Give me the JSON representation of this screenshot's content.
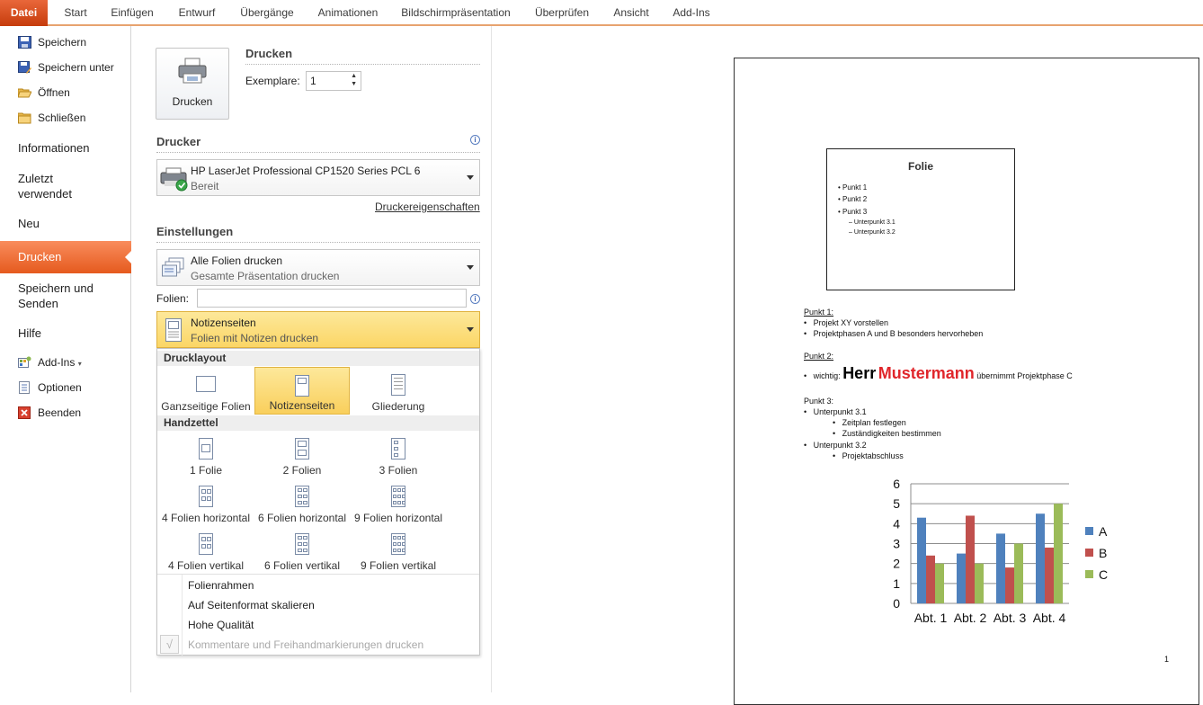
{
  "ribbon": {
    "tabs": [
      "Datei",
      "Start",
      "Einfügen",
      "Entwurf",
      "Übergänge",
      "Animationen",
      "Bildschirmpräsentation",
      "Überprüfen",
      "Ansicht",
      "Add-Ins"
    ]
  },
  "nav": {
    "save": "Speichern",
    "save_as": "Speichern unter",
    "open": "Öffnen",
    "close": "Schließen",
    "info": "Informationen",
    "recent": "Zuletzt\nverwendet",
    "new": "Neu",
    "print": "Drucken",
    "save_send": "Speichern und\nSenden",
    "help": "Hilfe",
    "addins": "Add-Ins",
    "options": "Optionen",
    "exit": "Beenden"
  },
  "print": {
    "heading": "Drucken",
    "button_label": "Drucken",
    "copies_label": "Exemplare:",
    "copies_value": "1"
  },
  "printer": {
    "heading": "Drucker",
    "name": "HP LaserJet Professional CP1520 Series PCL 6",
    "status": "Bereit",
    "properties_link": "Druckereigenschaften"
  },
  "settings": {
    "heading": "Einstellungen",
    "range_title": "Alle Folien drucken",
    "range_sub": "Gesamte Präsentation drucken",
    "slides_label": "Folien:",
    "slides_value": "",
    "layout_title": "Notizenseiten",
    "layout_sub": "Folien mit Notizen drucken"
  },
  "dropdown": {
    "print_layout_header": "Drucklayout",
    "print_layout": [
      "Ganzseitige Folien",
      "Notizenseiten",
      "Gliederung"
    ],
    "handouts_header": "Handzettel",
    "handouts": [
      "1 Folie",
      "2 Folien",
      "3 Folien",
      "4 Folien horizontal",
      "6 Folien horizontal",
      "9 Folien horizontal",
      "4 Folien vertikal",
      "6 Folien vertikal",
      "9 Folien vertikal"
    ],
    "frame": "Folienrahmen",
    "scale": "Auf Seitenformat skalieren",
    "quality": "Hohe Qualität",
    "comments": "Kommentare und Freihandmarkierungen drucken"
  },
  "preview": {
    "slide_title": "Folie",
    "slide_bullets": [
      "Punkt 1",
      "Punkt 2",
      "Punkt 3"
    ],
    "slide_sub": [
      "Unterpunkt 3.1",
      "Unterpunkt 3.2"
    ],
    "n1_head": "Punkt 1:",
    "n1_items": [
      "Projekt XY vorstellen",
      "Projektphasen  A und B besonders  hervorheben"
    ],
    "n2_head": "Punkt 2:",
    "n2_pre": "wichtig:",
    "n2_herr": "Herr",
    "n2_name": "Mustermann",
    "n2_post": "übernimmt  Projektphase  C",
    "n3_head": "Punkt 3:",
    "n3_a": "Unterpunkt  3.1",
    "n3_a_items": [
      "Zeitplan  festlegen",
      "Zuständigkeiten  bestimmen"
    ],
    "n3_b": "Unterpunkt  3.2",
    "n3_b_items": [
      "Projektabschluss"
    ],
    "page_number": "1"
  },
  "chart_data": {
    "type": "bar",
    "categories": [
      "Abt. 1",
      "Abt. 2",
      "Abt. 3",
      "Abt. 4"
    ],
    "series": [
      {
        "name": "A",
        "values": [
          4.3,
          2.5,
          3.5,
          4.5
        ],
        "color": "#4f81bd"
      },
      {
        "name": "B",
        "values": [
          2.4,
          4.4,
          1.8,
          2.8
        ],
        "color": "#c0504d"
      },
      {
        "name": "C",
        "values": [
          2,
          2,
          3,
          5
        ],
        "color": "#9bbb59"
      }
    ],
    "ylim": [
      0,
      6
    ],
    "yticks": [
      "0",
      "1",
      "2",
      "3",
      "4",
      "5",
      "6"
    ],
    "grid": true,
    "legend": "right"
  }
}
